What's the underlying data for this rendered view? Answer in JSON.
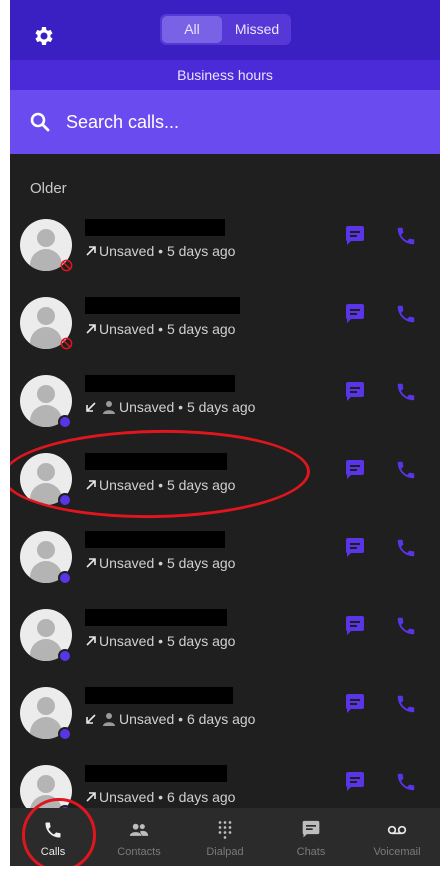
{
  "header": {
    "filter_tabs": [
      {
        "label": "All",
        "selected": true
      },
      {
        "label": "Missed",
        "selected": false
      }
    ],
    "settings_icon": "gear-icon"
  },
  "business_hours": "Business hours",
  "search": {
    "placeholder": "Search calls..."
  },
  "section_title": "Older",
  "calls": [
    {
      "direction": "outgoing",
      "status": "missed",
      "unsaved_icon": false,
      "label": "Unsaved",
      "sep": "•",
      "time": "5 days ago"
    },
    {
      "direction": "outgoing",
      "status": "missed",
      "unsaved_icon": false,
      "label": "Unsaved",
      "sep": "•",
      "time": "5 days ago"
    },
    {
      "direction": "incoming",
      "status": "online",
      "unsaved_icon": true,
      "label": "Unsaved",
      "sep": "•",
      "time": "5 days ago"
    },
    {
      "direction": "outgoing",
      "status": "online",
      "unsaved_icon": false,
      "label": "Unsaved",
      "sep": "•",
      "time": "5 days ago"
    },
    {
      "direction": "outgoing",
      "status": "online",
      "unsaved_icon": false,
      "label": "Unsaved",
      "sep": "•",
      "time": "5 days ago"
    },
    {
      "direction": "outgoing",
      "status": "online",
      "unsaved_icon": false,
      "label": "Unsaved",
      "sep": "•",
      "time": "5 days ago"
    },
    {
      "direction": "incoming",
      "status": "online",
      "unsaved_icon": true,
      "label": "Unsaved",
      "sep": "•",
      "time": "6 days ago"
    },
    {
      "direction": "outgoing",
      "status": "online",
      "unsaved_icon": false,
      "label": "Unsaved",
      "sep": "•",
      "time": "6 days ago"
    }
  ],
  "nav": [
    {
      "label": "Calls",
      "icon": "phone-icon",
      "active": true
    },
    {
      "label": "Contacts",
      "icon": "contacts-icon",
      "active": false
    },
    {
      "label": "Dialpad",
      "icon": "dialpad-icon",
      "active": false
    },
    {
      "label": "Chats",
      "icon": "chat-icon",
      "active": false
    },
    {
      "label": "Voicemail",
      "icon": "voicemail-icon",
      "active": false
    }
  ],
  "colors": {
    "accent": "#5a35e8",
    "header_bg": "#3a1fc2",
    "search_bg": "#6a4bf0",
    "annotation": "#e0161e"
  }
}
